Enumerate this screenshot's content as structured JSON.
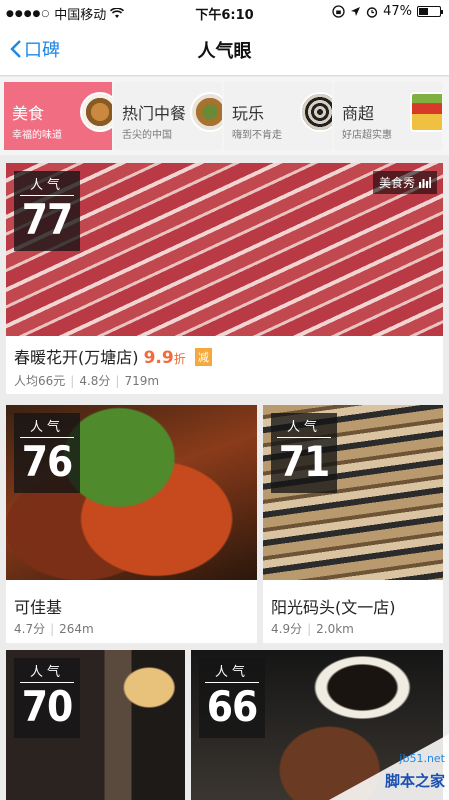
{
  "status_bar": {
    "carrier": "中国移动",
    "time": "下午6:10",
    "battery": "47%",
    "battery_level": 0.47
  },
  "nav": {
    "back_label": "口碑",
    "title": "人气眼"
  },
  "categories": [
    {
      "label": "美食",
      "sub": "幸福的味道",
      "active": true
    },
    {
      "label": "热门中餐",
      "sub": "舌尖的中国",
      "active": false
    },
    {
      "label": "玩乐",
      "sub": "嗨到不肯走",
      "active": false
    },
    {
      "label": "商超",
      "sub": "好店超实惠",
      "active": false
    }
  ],
  "badge_label": "人气",
  "featured": {
    "rank": "77",
    "tag": "美食秀",
    "name": "春暖花开(万塘店)",
    "price": "9.9",
    "price_unit": "折",
    "discount": "减",
    "per_person": "人均66元",
    "score": "4.8分",
    "distance": "719m"
  },
  "cards": [
    {
      "rank": "76",
      "name": "可佳基",
      "score": "4.7分",
      "distance": "264m"
    },
    {
      "rank": "71",
      "name": "阳光码头(文一店)",
      "score": "4.9分",
      "distance": "2.0km"
    },
    {
      "rank": "70"
    },
    {
      "rank": "66"
    }
  ],
  "watermark": {
    "site": "jb51.net",
    "text": "脚本之家"
  },
  "colors": {
    "accent_blue": "#1e88e5",
    "active_tab": "#f06d82",
    "price": "#f26b3a",
    "discount_badge": "#f4a93a"
  }
}
